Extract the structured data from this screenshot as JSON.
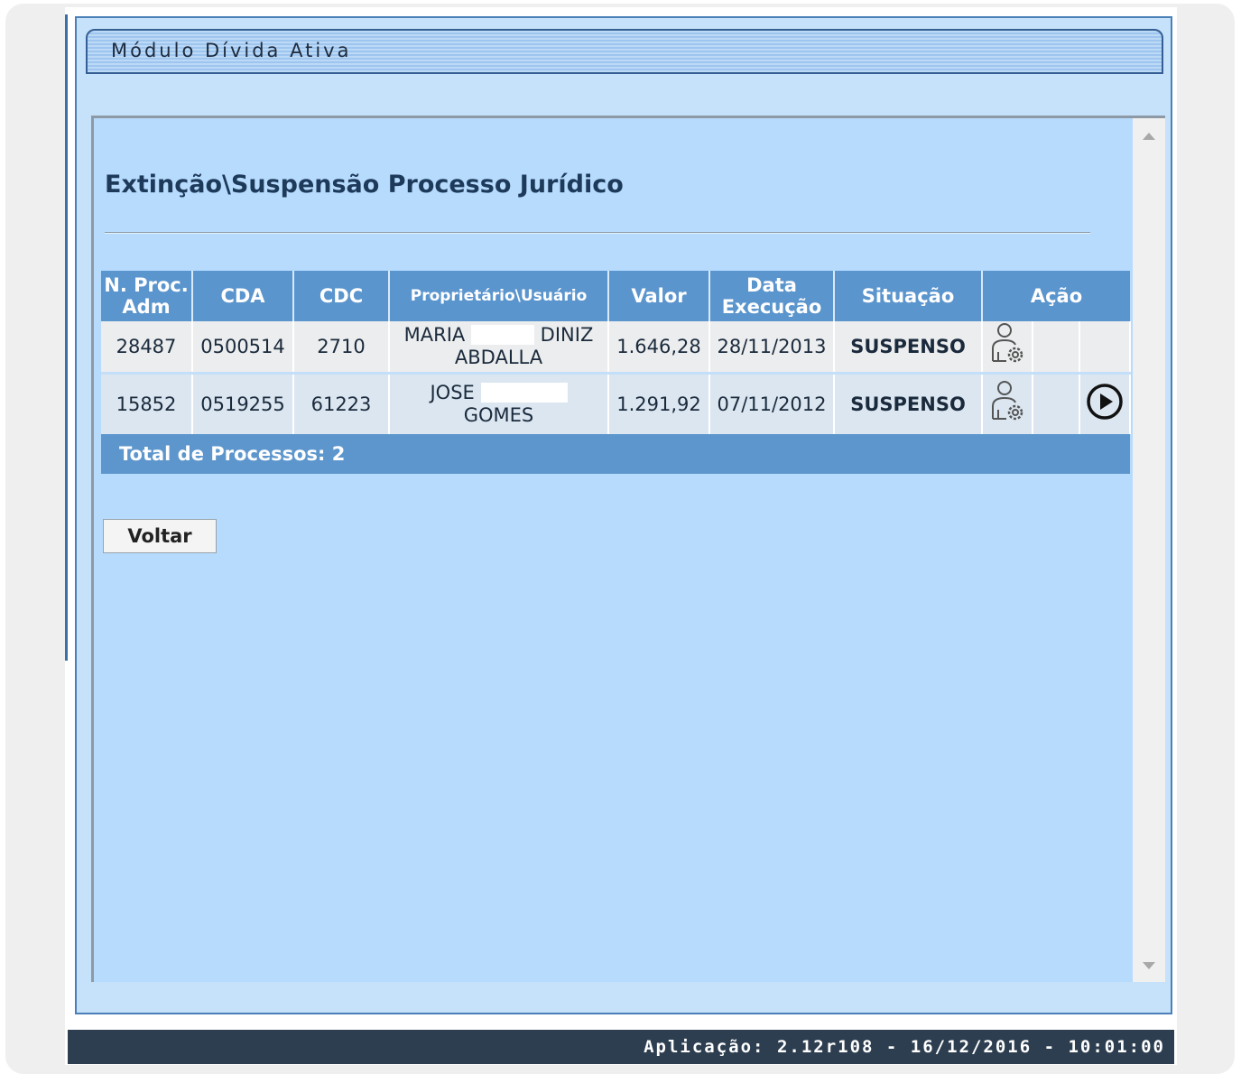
{
  "module": {
    "title": "Módulo Dívida Ativa"
  },
  "page": {
    "title": "Extinção\\Suspensão Processo Jurídico"
  },
  "table": {
    "headers": {
      "nproc": [
        "N. Proc.",
        "Adm"
      ],
      "cda": "CDA",
      "cdc": "CDC",
      "owner": "Proprietário\\Usuário",
      "valor": "Valor",
      "data": [
        "Data",
        "Execução"
      ],
      "situacao": "Situação",
      "acao": "Ação"
    },
    "rows": [
      {
        "nproc": "28487",
        "cda": "0500514",
        "cdc": "2710",
        "owner_line1_start": "MARIA",
        "owner_line1_end": "DINIZ",
        "owner_line2": "ABDALLA",
        "valor": "1.646,28",
        "data": "28/11/2013",
        "situacao": "SUSPENSO",
        "icons": [
          "user-settings-icon"
        ]
      },
      {
        "nproc": "15852",
        "cda": "0519255",
        "cdc": "61223",
        "owner_line1_start": "JOSE",
        "owner_line1_end": "",
        "owner_line2": "GOMES",
        "valor": "1.291,92",
        "data": "07/11/2012",
        "situacao": "SUSPENSO",
        "icons": [
          "user-settings-icon",
          "play-circle-icon"
        ]
      }
    ],
    "total_label": "Total de Processos: 2"
  },
  "buttons": {
    "voltar": "Voltar"
  },
  "status": {
    "app_info": "Aplicação: 2.12r108 - 16/12/2016 - 10:01:00"
  },
  "colors": {
    "header_bg": "#5b95cd",
    "panel_bg": "#b6dbfd",
    "status_text": "#10156b",
    "statusbar_bg": "#2d3e50"
  }
}
